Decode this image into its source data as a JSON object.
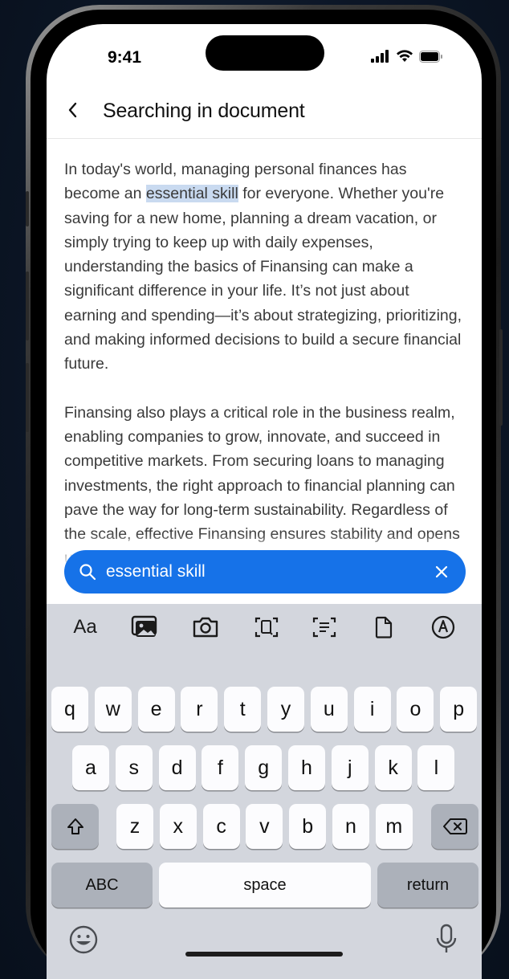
{
  "status": {
    "time": "9:41"
  },
  "nav": {
    "title": "Searching in document"
  },
  "document": {
    "p1_before": "In today's world, managing personal finances has become an ",
    "p1_highlight": "essential skill",
    "p1_after": " for everyone. Whether you're saving for a new home, planning a dream vacation, or simply trying to keep up with daily expenses, understanding the basics of Finansing can make a significant difference in your life. It’s not just about earning and spending—it’s about strategizing, prioritizing, and making informed decisions to build a secure financial future.",
    "p2": "Finansing also plays a critical role in the business realm, enabling companies to grow, innovate, and succeed in competitive markets. From securing loans to managing investments, the right approach to financial planning can pave the way for long-term sustainability. Regardless of the scale, effective Finansing ensures stability and opens up"
  },
  "search": {
    "query": "essential skill",
    "accent": "#1672e8"
  },
  "toolbar": {
    "items": [
      {
        "label": "Aa"
      },
      {
        "icon": "photo-library-icon"
      },
      {
        "icon": "camera-icon"
      },
      {
        "icon": "scan-document-icon"
      },
      {
        "icon": "scan-text-icon"
      },
      {
        "icon": "file-icon"
      },
      {
        "icon": "markup-icon"
      }
    ]
  },
  "keyboard": {
    "row1": [
      "q",
      "w",
      "e",
      "r",
      "t",
      "y",
      "u",
      "i",
      "o",
      "p"
    ],
    "row2": [
      "a",
      "s",
      "d",
      "f",
      "g",
      "h",
      "j",
      "k",
      "l"
    ],
    "row3": [
      "z",
      "x",
      "c",
      "v",
      "b",
      "n",
      "m"
    ],
    "abc_label": "ABC",
    "space_label": "space",
    "return_label": "return"
  }
}
